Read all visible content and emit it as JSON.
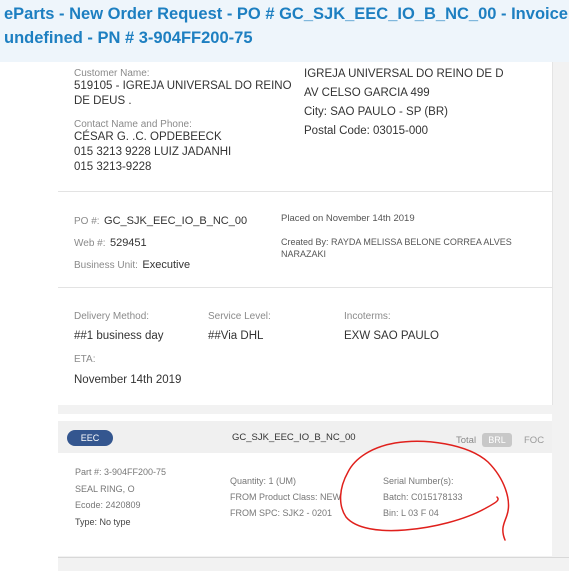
{
  "header": {
    "title_line1": "eParts - New Order Request - PO # GC_SJK_EEC_IO_B_NC_00 - Invoice #",
    "title_line2": "undefined - PN # 3-904FF200-75"
  },
  "customer": {
    "name_label": "Customer Name:",
    "name_line1": "519105 - IGREJA UNIVERSAL DO REINO",
    "name_line2": "DE DEUS .",
    "contact_label": "Contact Name and Phone:",
    "contact_line1": "CÉSAR G. .C. OPDEBEECK",
    "contact_line2": "015 3213 9228 LUIZ JADANHI",
    "contact_line3": "015 3213-9228"
  },
  "address": {
    "line1": "IGREJA UNIVERSAL DO REINO DE D",
    "line2": "AV CELSO GARCIA 499",
    "line3": "City: SAO PAULO - SP (BR)",
    "line4": "Postal Code: 03015-000"
  },
  "order": {
    "po_label": "PO #:",
    "po_value": "GC_SJK_EEC_IO_B_NC_00",
    "web_label": "Web #:",
    "web_value": "529451",
    "bu_label": "Business Unit:",
    "bu_value": "Executive",
    "placed": "Placed on November 14th 2019",
    "created_line1": "Created By: RAYDA MELISSA BELONE CORREA ALVES",
    "created_line2": "NARAZAKI"
  },
  "shipping": {
    "delivery_label": "Delivery Method:",
    "delivery_value": "##1 business day",
    "service_label": "Service Level:",
    "service_value": "##Via DHL",
    "incoterms_label": "Incoterms:",
    "incoterms_value": "EXW SAO PAULO",
    "eta_label": "ETA:",
    "eta_value": "November 14th 2019"
  },
  "line_item": {
    "badge": "EEC",
    "po": "GC_SJK_EEC_IO_B_NC_00",
    "total_label": "Total",
    "currency": "BRL",
    "foc": "FOC",
    "part": "Part #: 3-904FF200-75",
    "description": "SEAL RING, O",
    "ecode": "Ecode: 2420809",
    "type": "Type: No type",
    "quantity": "Quantity: 1 (UM)",
    "from_class": "FROM Product Class: NEW",
    "from_spc": "FROM SPC: SJK2 - 0201",
    "serial": "Serial Number(s):",
    "batch": "Batch: C015178133",
    "bin": "Bin: L 03 F 04"
  },
  "colors": {
    "title": "#1d7fc1",
    "badge": "#34568f",
    "annotation": "#e0201c"
  }
}
